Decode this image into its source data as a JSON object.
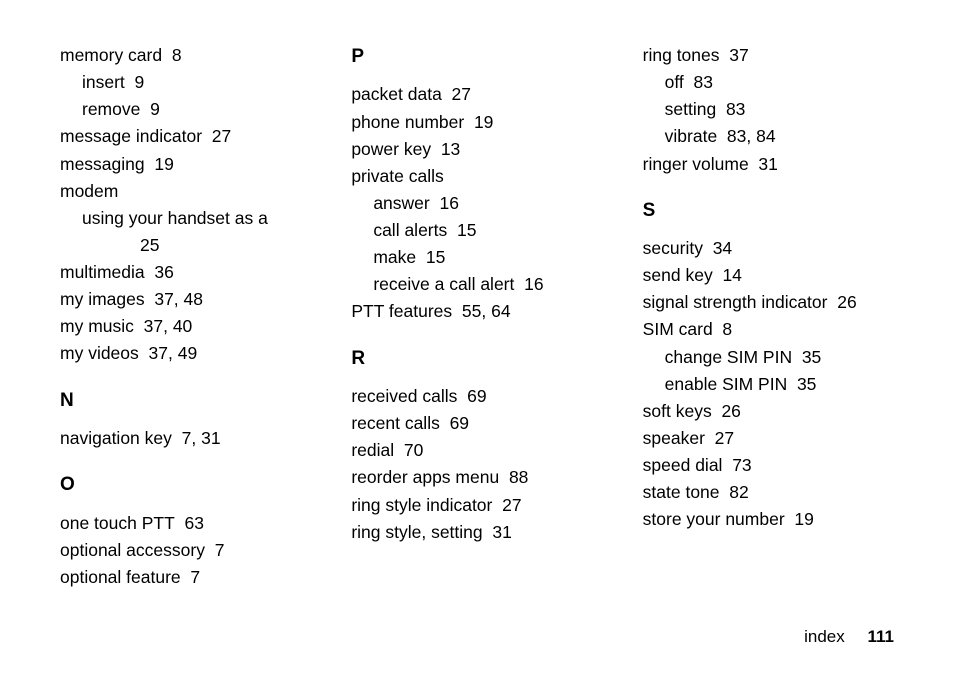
{
  "col1": {
    "e1": {
      "t": "memory card",
      "p": "8"
    },
    "e2": {
      "t": "insert",
      "p": "9"
    },
    "e3": {
      "t": "remove",
      "p": "9"
    },
    "e4": {
      "t": "message indicator",
      "p": "27"
    },
    "e5": {
      "t": "messaging",
      "p": "19"
    },
    "e6": {
      "t": "modem",
      "p": ""
    },
    "e7": {
      "t": "using your handset as a",
      "p": ""
    },
    "e7b": {
      "t": "",
      "p": "25"
    },
    "e8": {
      "t": "multimedia",
      "p": "36"
    },
    "e9": {
      "t": "my images",
      "p": "37, 48"
    },
    "e10": {
      "t": "my music",
      "p": "37, 40"
    },
    "e11": {
      "t": "my videos",
      "p": "37, 49"
    },
    "hN": "N",
    "e12": {
      "t": "navigation key",
      "p": "7, 31"
    },
    "hO": "O",
    "e13": {
      "t": "one touch PTT",
      "p": "63"
    },
    "e14": {
      "t": "optional accessory",
      "p": "7"
    },
    "e15": {
      "t": "optional feature",
      "p": "7"
    }
  },
  "col2": {
    "hP": "P",
    "e1": {
      "t": "packet data",
      "p": "27"
    },
    "e2": {
      "t": "phone number",
      "p": "19"
    },
    "e3": {
      "t": "power key",
      "p": "13"
    },
    "e4": {
      "t": "private calls",
      "p": ""
    },
    "e5": {
      "t": "answer",
      "p": "16"
    },
    "e6": {
      "t": "call alerts",
      "p": "15"
    },
    "e7": {
      "t": "make",
      "p": "15"
    },
    "e8": {
      "t": "receive a call alert",
      "p": "16"
    },
    "e9": {
      "t": "PTT features",
      "p": "55, 64"
    },
    "hR": "R",
    "e10": {
      "t": "received calls",
      "p": "69"
    },
    "e11": {
      "t": "recent calls",
      "p": "69"
    },
    "e12": {
      "t": "redial",
      "p": "70"
    },
    "e13": {
      "t": "reorder apps menu",
      "p": "88"
    },
    "e14": {
      "t": "ring style indicator",
      "p": "27"
    },
    "e15": {
      "t": "ring style, setting",
      "p": "31"
    }
  },
  "col3": {
    "e1": {
      "t": "ring tones",
      "p": "37"
    },
    "e2": {
      "t": "off",
      "p": "83"
    },
    "e3": {
      "t": "setting",
      "p": "83"
    },
    "e4": {
      "t": "vibrate",
      "p": "83, 84"
    },
    "e5": {
      "t": "ringer volume",
      "p": "31"
    },
    "hS": "S",
    "e6": {
      "t": "security",
      "p": "34"
    },
    "e7": {
      "t": "send key",
      "p": "14"
    },
    "e8": {
      "t": "signal strength indicator",
      "p": "26"
    },
    "e9": {
      "t": "SIM card",
      "p": "8"
    },
    "e10": {
      "t": "change SIM PIN",
      "p": "35"
    },
    "e11": {
      "t": "enable SIM PIN",
      "p": "35"
    },
    "e12": {
      "t": "soft keys",
      "p": "26"
    },
    "e13": {
      "t": "speaker",
      "p": "27"
    },
    "e14": {
      "t": "speed dial",
      "p": "73"
    },
    "e15": {
      "t": "state tone",
      "p": "82"
    },
    "e16": {
      "t": "store your number",
      "p": "19"
    }
  },
  "footer": {
    "label": "index",
    "page": "111"
  }
}
